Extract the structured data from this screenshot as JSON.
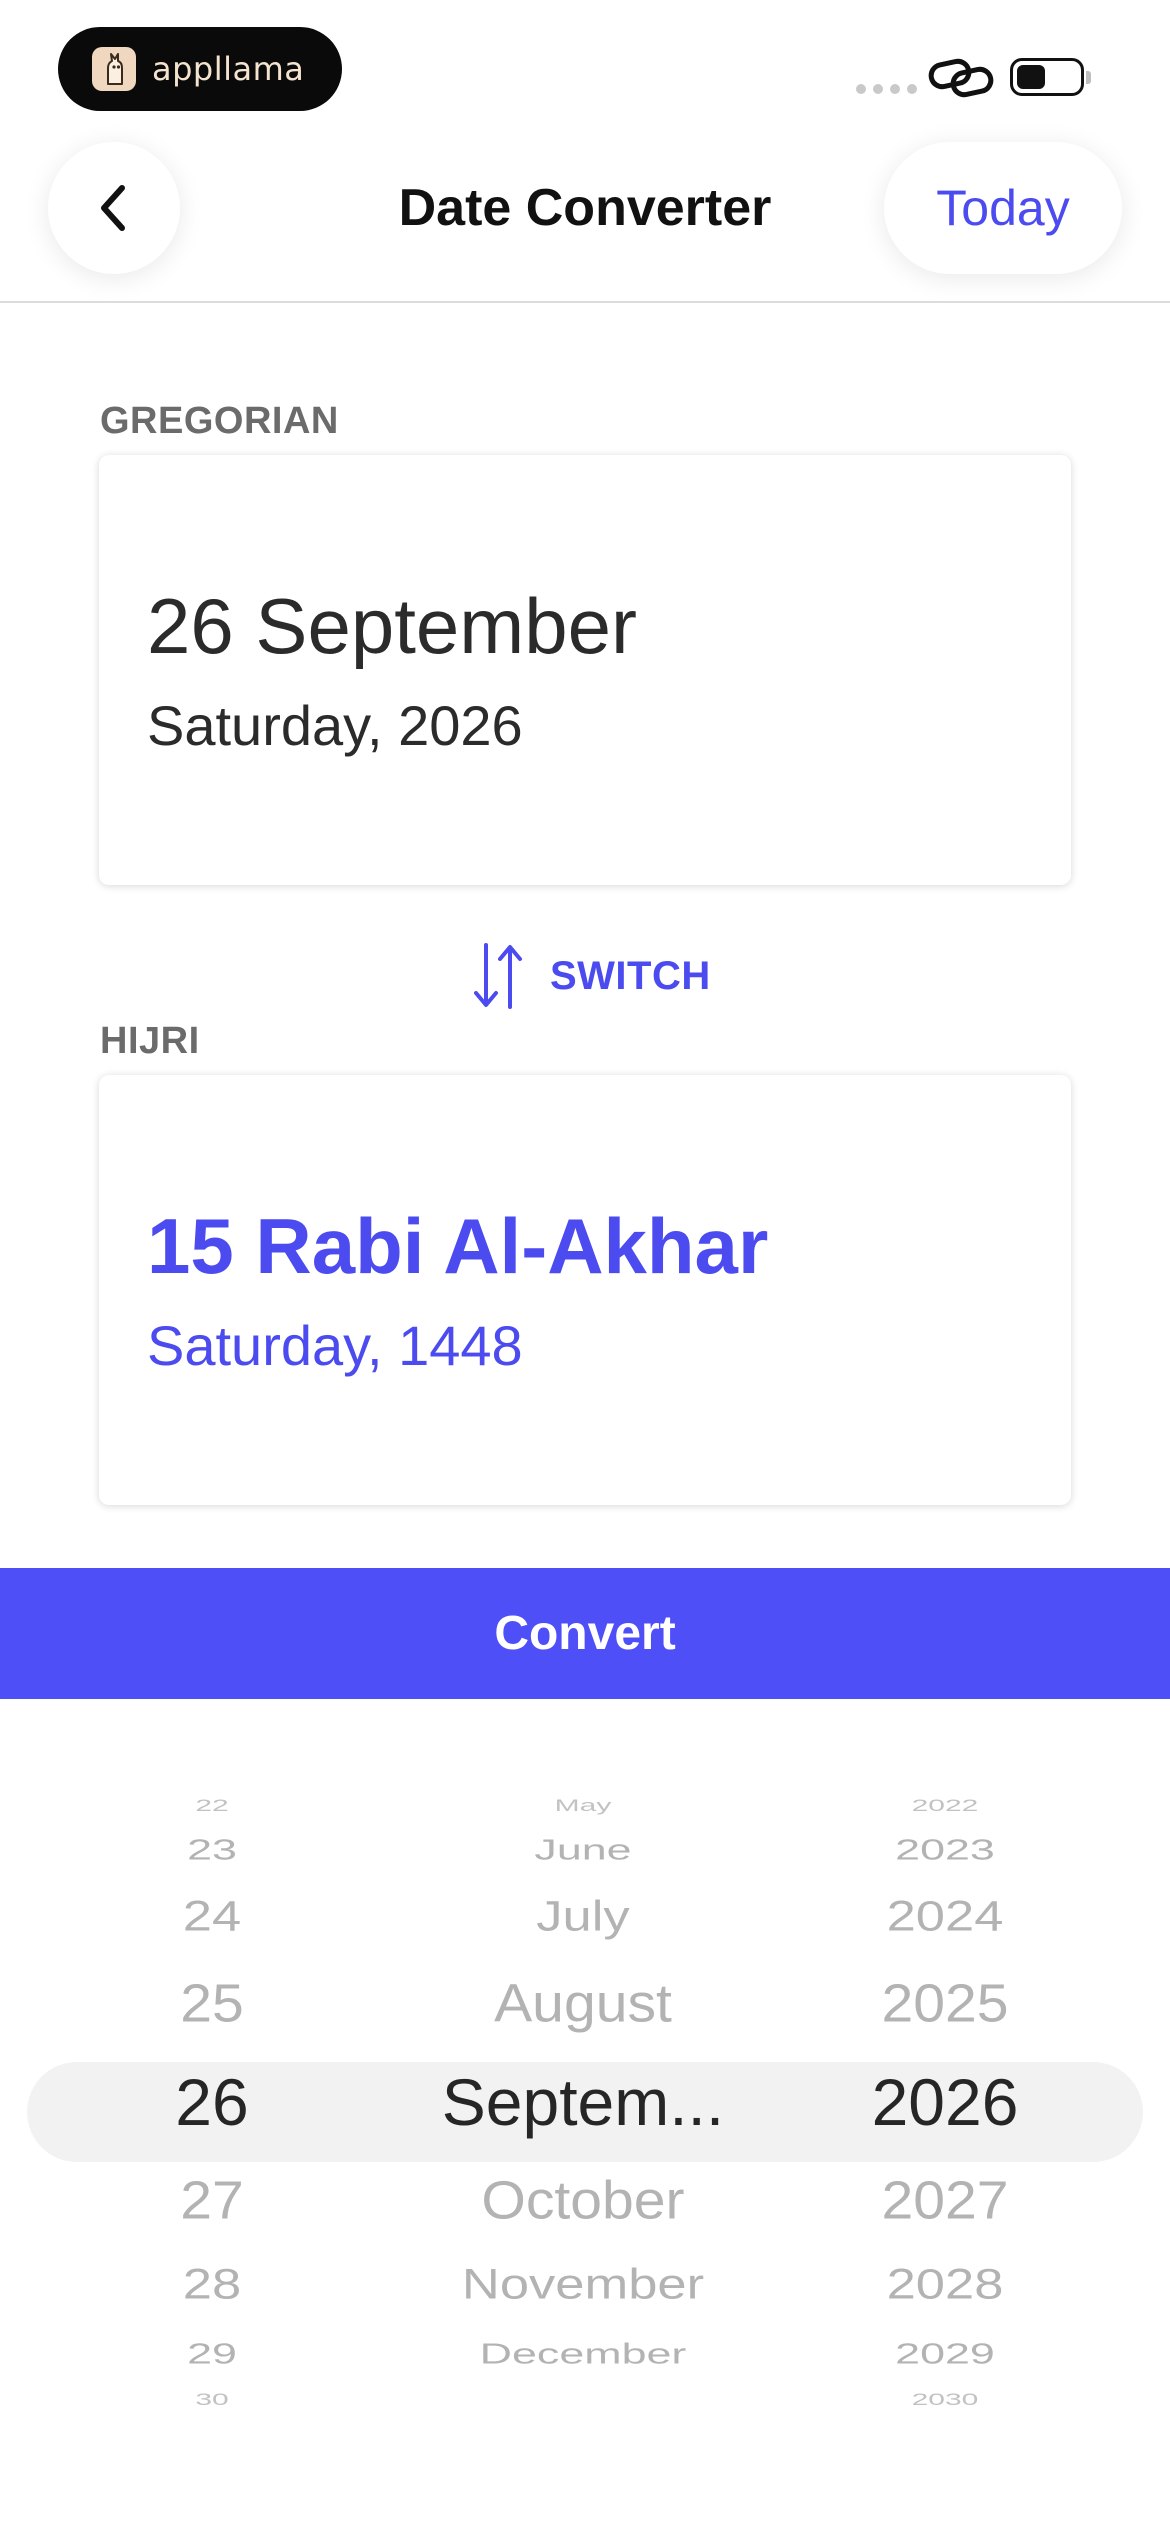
{
  "status_bar": {
    "app_name": "appllama",
    "app_logo_icon": "llama-icon",
    "link_icon": "link-icon",
    "battery_icon": "battery-icon"
  },
  "nav": {
    "back_icon": "chevron-left-icon",
    "title": "Date Converter",
    "today_label": "Today"
  },
  "gregorian": {
    "label": "GREGORIAN",
    "day_month": "26 September",
    "weekday_year": "Saturday, 2026"
  },
  "switch": {
    "icon": "swap-vertical-icon",
    "label": "SWITCH"
  },
  "hijri": {
    "label": "HIJRI",
    "day_month": "15 Rabi Al-Akhar",
    "weekday_year": "Saturday, 1448"
  },
  "convert": {
    "label": "Convert"
  },
  "picker": {
    "days": [
      "22",
      "23",
      "24",
      "25",
      "26",
      "27",
      "28",
      "29",
      "30"
    ],
    "months": [
      "May",
      "June",
      "July",
      "August",
      "Septem...",
      "October",
      "November",
      "December",
      ""
    ],
    "years": [
      "2022",
      "2023",
      "2024",
      "2025",
      "2026",
      "2027",
      "2028",
      "2029",
      "2030"
    ],
    "selected_index": 4
  },
  "colors": {
    "accent": "#4f4ff8",
    "accent_text": "#4b4bf0",
    "label_gray": "#6b6b6b",
    "picker_inactive": "#b3b3b3"
  }
}
